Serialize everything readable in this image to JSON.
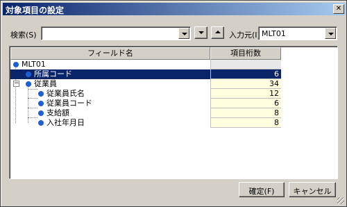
{
  "window": {
    "title": "対象項目の設定"
  },
  "search": {
    "label": "検索(S)",
    "value": ""
  },
  "source": {
    "label": "入力元(I)",
    "value": "MLT01"
  },
  "table": {
    "headers": [
      "フィールド名",
      "項目桁数"
    ],
    "rows": [
      {
        "name": "MLT01",
        "digits": ""
      },
      {
        "name": "所属コード",
        "digits": "6"
      },
      {
        "name": "従業員",
        "digits": "34"
      },
      {
        "name": "従業員氏名",
        "digits": "12"
      },
      {
        "name": "従業員コード",
        "digits": "6"
      },
      {
        "name": "支給額",
        "digits": "8"
      },
      {
        "name": "入社年月日",
        "digits": "8"
      }
    ]
  },
  "buttons": {
    "ok": "確定(F)",
    "cancel": "キャンセル"
  },
  "colors": {
    "title_start": "#0a246a",
    "selection": "#0a246a",
    "node": "#1e5fd6",
    "digits_bg": "#ffffe0"
  }
}
